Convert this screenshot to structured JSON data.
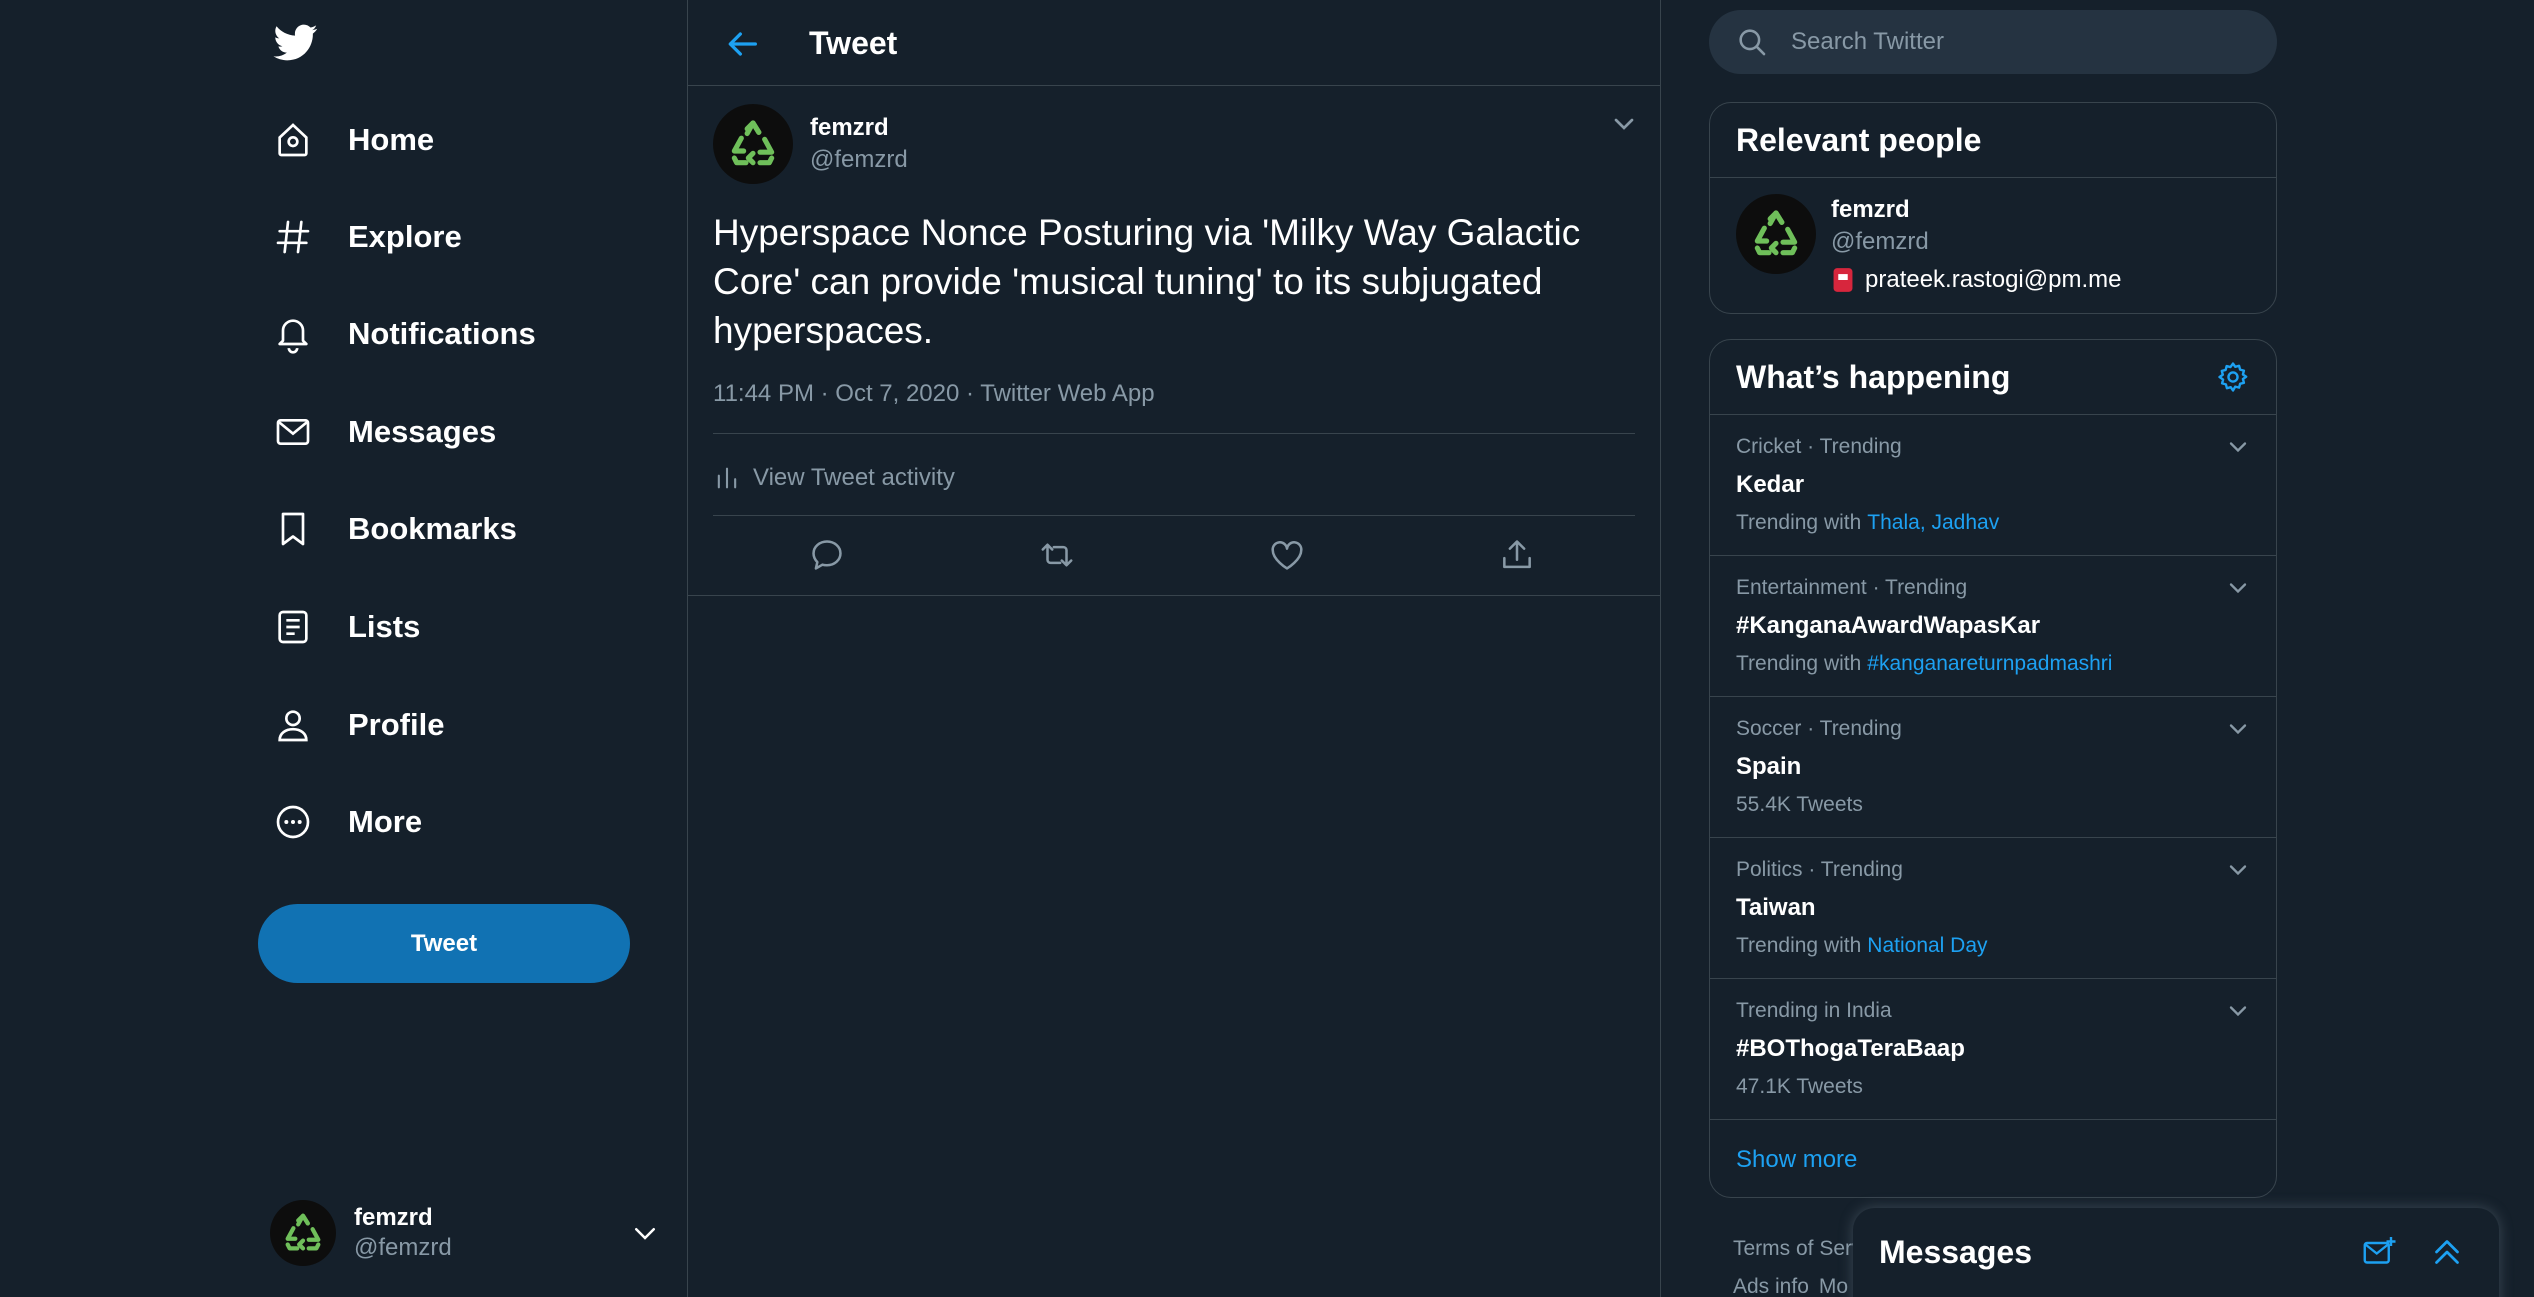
{
  "nav": {
    "items": [
      {
        "label": "Home",
        "icon": "home-icon"
      },
      {
        "label": "Explore",
        "icon": "hashtag-icon"
      },
      {
        "label": "Notifications",
        "icon": "bell-icon"
      },
      {
        "label": "Messages",
        "icon": "envelope-icon"
      },
      {
        "label": "Bookmarks",
        "icon": "bookmark-icon"
      },
      {
        "label": "Lists",
        "icon": "list-icon"
      },
      {
        "label": "Profile",
        "icon": "person-icon"
      },
      {
        "label": "More",
        "icon": "more-icon"
      }
    ],
    "tweet_button": "Tweet"
  },
  "account": {
    "name": "femzrd",
    "handle": "@femzrd"
  },
  "header": {
    "title": "Tweet"
  },
  "tweet": {
    "author_name": "femzrd",
    "author_handle": "@femzrd",
    "text": "Hyperspace Nonce Posturing via 'Milky Way Galactic Core' can provide 'musical tuning' to its subjugated hyperspaces.",
    "meta": "11:44 PM · Oct 7, 2020 · Twitter Web App",
    "activity_label": "View Tweet activity"
  },
  "search": {
    "placeholder": "Search Twitter"
  },
  "relevant_people": {
    "title": "Relevant people",
    "person": {
      "name": "femzrd",
      "handle": "@femzrd",
      "bio": "prateek.rastogi@pm.me"
    }
  },
  "whats_happening": {
    "title": "What’s happening",
    "trends": [
      {
        "context": "Cricket · Trending",
        "topic": "Kedar",
        "sub_prefix": "Trending with",
        "sub_link": "Thala, Jadhav",
        "sub_text": ""
      },
      {
        "context": "Entertainment · Trending",
        "topic": "#KanganaAwardWapasKar",
        "sub_prefix": "Trending with",
        "sub_link": "#kanganareturnpadmashri",
        "sub_text": ""
      },
      {
        "context": "Soccer · Trending",
        "topic": "Spain",
        "sub_prefix": "",
        "sub_link": "",
        "sub_text": "55.4K Tweets"
      },
      {
        "context": "Politics · Trending",
        "topic": "Taiwan",
        "sub_prefix": "Trending with",
        "sub_link": "National Day",
        "sub_text": ""
      },
      {
        "context": "Trending in India",
        "topic": "#BOThogaTeraBaap",
        "sub_prefix": "",
        "sub_link": "",
        "sub_text": "47.1K Tweets"
      }
    ],
    "show_more": "Show more"
  },
  "footer": {
    "line1": "Terms of Serv",
    "line2a": "Ads info",
    "line2b": "Mo"
  },
  "messages_drawer": {
    "title": "Messages"
  },
  "colors": {
    "background": "#15202b",
    "accent": "#1da1f2",
    "tweet_button": "#1172b3",
    "border": "#38444d",
    "muted": "#8899a6"
  }
}
